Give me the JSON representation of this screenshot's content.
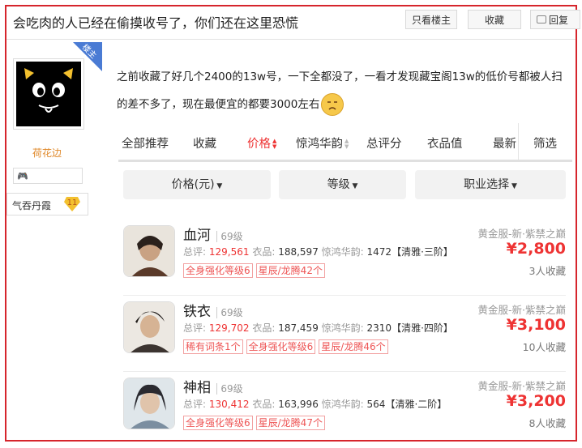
{
  "header": {
    "title": "会吃肉的人已经在偷摸收号了，你们还在这里恐慌",
    "only_op_label": "只看楼主",
    "favorite_label": "收藏",
    "reply_label": "回复"
  },
  "author": {
    "op_badge": "楼主",
    "name": "荷花边",
    "level_name": "气吞丹霞",
    "level_num": "11"
  },
  "post": {
    "text_line1": "之前收藏了好几个2400的13w号，一下全都没了，一看才发现藏宝阁13w的低价号都被人扫",
    "text_line2": "的差不多了，现在最便宜的都要3000左右"
  },
  "tabs": [
    {
      "label": "全部推荐"
    },
    {
      "label": "收藏"
    },
    {
      "label": "价格"
    },
    {
      "label": "惊鸿华韵"
    },
    {
      "label": "总评分"
    },
    {
      "label": "衣品值"
    },
    {
      "label": "最新"
    },
    {
      "label": "筛选"
    }
  ],
  "filters": {
    "price": "价格(元)",
    "grade": "等级",
    "class": "职业选择"
  },
  "listings": [
    {
      "name": "血河",
      "level": "69级",
      "score_label": "总评:",
      "score": "129,561",
      "outfit_label": "衣品:",
      "outfit": "188,597",
      "jh_label": "惊鸿华韵:",
      "jh": "1472",
      "tier": "【清雅·三阶】",
      "tags": [
        "全身强化等级6",
        "星辰/龙腾42个"
      ],
      "server": "黄金服-新·紫禁之巅",
      "price": "¥2,800",
      "fav": "3人收藏"
    },
    {
      "name": "铁衣",
      "level": "69级",
      "score_label": "总评:",
      "score": "129,702",
      "outfit_label": "衣品:",
      "outfit": "187,459",
      "jh_label": "惊鸿华韵:",
      "jh": "2310",
      "tier": "【清雅·四阶】",
      "tags": [
        "稀有词条1个",
        "全身强化等级6",
        "星辰/龙腾46个"
      ],
      "server": "黄金服-新·紫禁之巅",
      "price": "¥3,100",
      "fav": "10人收藏"
    },
    {
      "name": "神相",
      "level": "69级",
      "score_label": "总评:",
      "score": "130,412",
      "outfit_label": "衣品:",
      "outfit": "163,996",
      "jh_label": "惊鸿华韵:",
      "jh": "564",
      "tier": "【清雅·二阶】",
      "tags": [
        "全身强化等级6",
        "星辰/龙腾47个"
      ],
      "server": "黄金服-新·紫禁之巅",
      "price": "¥3,200",
      "fav": "8人收藏"
    }
  ],
  "colors": {
    "frame": "#d6252c",
    "accent_red": "#e33",
    "author_name": "#e08a2c",
    "op_badge": "#4a7bd4"
  }
}
